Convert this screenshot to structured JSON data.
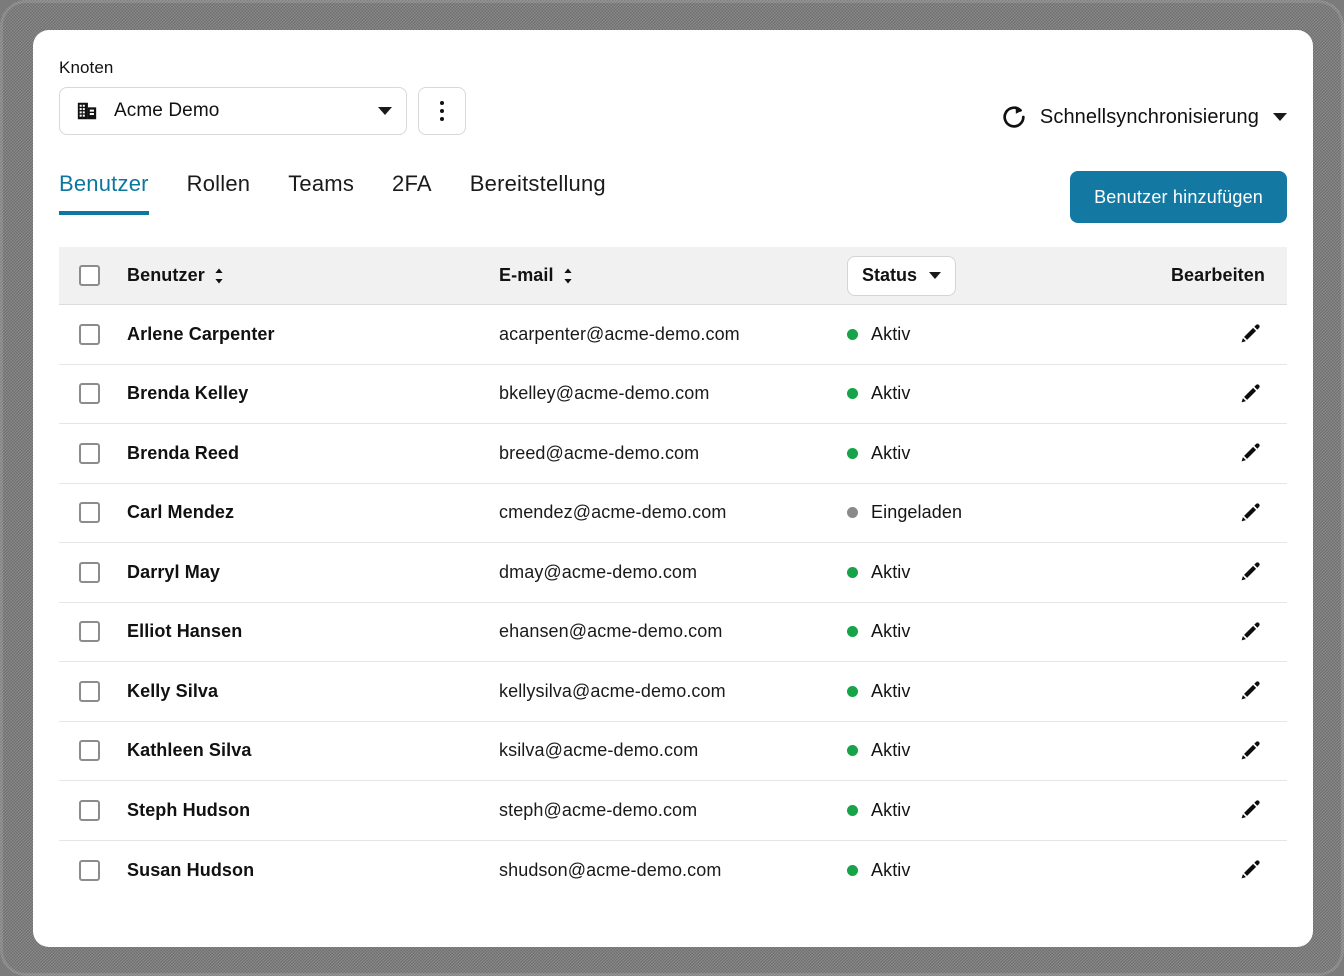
{
  "node": {
    "label": "Knoten",
    "selected": "Acme Demo",
    "icon": "building-icon",
    "menu_icon": "kebab-menu-icon"
  },
  "sync": {
    "label": "Schnellsynchronisierung",
    "icon": "refresh-icon"
  },
  "tabs": [
    {
      "label": "Benutzer",
      "active": true
    },
    {
      "label": "Rollen",
      "active": false
    },
    {
      "label": "Teams",
      "active": false
    },
    {
      "label": "2FA",
      "active": false
    },
    {
      "label": "Bereitstellung",
      "active": false
    }
  ],
  "actions": {
    "add_user": "Benutzer hinzufügen"
  },
  "table": {
    "headers": {
      "user": "Benutzer",
      "email": "E-mail",
      "status": "Status",
      "edit": "Bearbeiten"
    },
    "rows": [
      {
        "name": "Arlene Carpenter",
        "email": "acarpenter@acme-demo.com",
        "status": "Aktiv",
        "status_color": "#16a34a"
      },
      {
        "name": "Brenda Kelley",
        "email": "bkelley@acme-demo.com",
        "status": "Aktiv",
        "status_color": "#16a34a"
      },
      {
        "name": "Brenda Reed",
        "email": "breed@acme-demo.com",
        "status": "Aktiv",
        "status_color": "#16a34a"
      },
      {
        "name": "Carl Mendez",
        "email": "cmendez@acme-demo.com",
        "status": "Eingeladen",
        "status_color": "#8a8a8a"
      },
      {
        "name": "Darryl May",
        "email": "dmay@acme-demo.com",
        "status": "Aktiv",
        "status_color": "#16a34a"
      },
      {
        "name": "Elliot Hansen",
        "email": "ehansen@acme-demo.com",
        "status": "Aktiv",
        "status_color": "#16a34a"
      },
      {
        "name": "Kelly Silva",
        "email": "kellysilva@acme-demo.com",
        "status": "Aktiv",
        "status_color": "#16a34a"
      },
      {
        "name": "Kathleen Silva",
        "email": "ksilva@acme-demo.com",
        "status": "Aktiv",
        "status_color": "#16a34a"
      },
      {
        "name": "Steph Hudson",
        "email": "steph@acme-demo.com",
        "status": "Aktiv",
        "status_color": "#16a34a"
      },
      {
        "name": "Susan Hudson",
        "email": "shudson@acme-demo.com",
        "status": "Aktiv",
        "status_color": "#16a34a"
      }
    ]
  },
  "colors": {
    "accent": "#0d77a0",
    "button": "#1379a3",
    "active_status": "#16a34a",
    "invited_status": "#8a8a8a",
    "header_bg": "#f1f1f1"
  }
}
